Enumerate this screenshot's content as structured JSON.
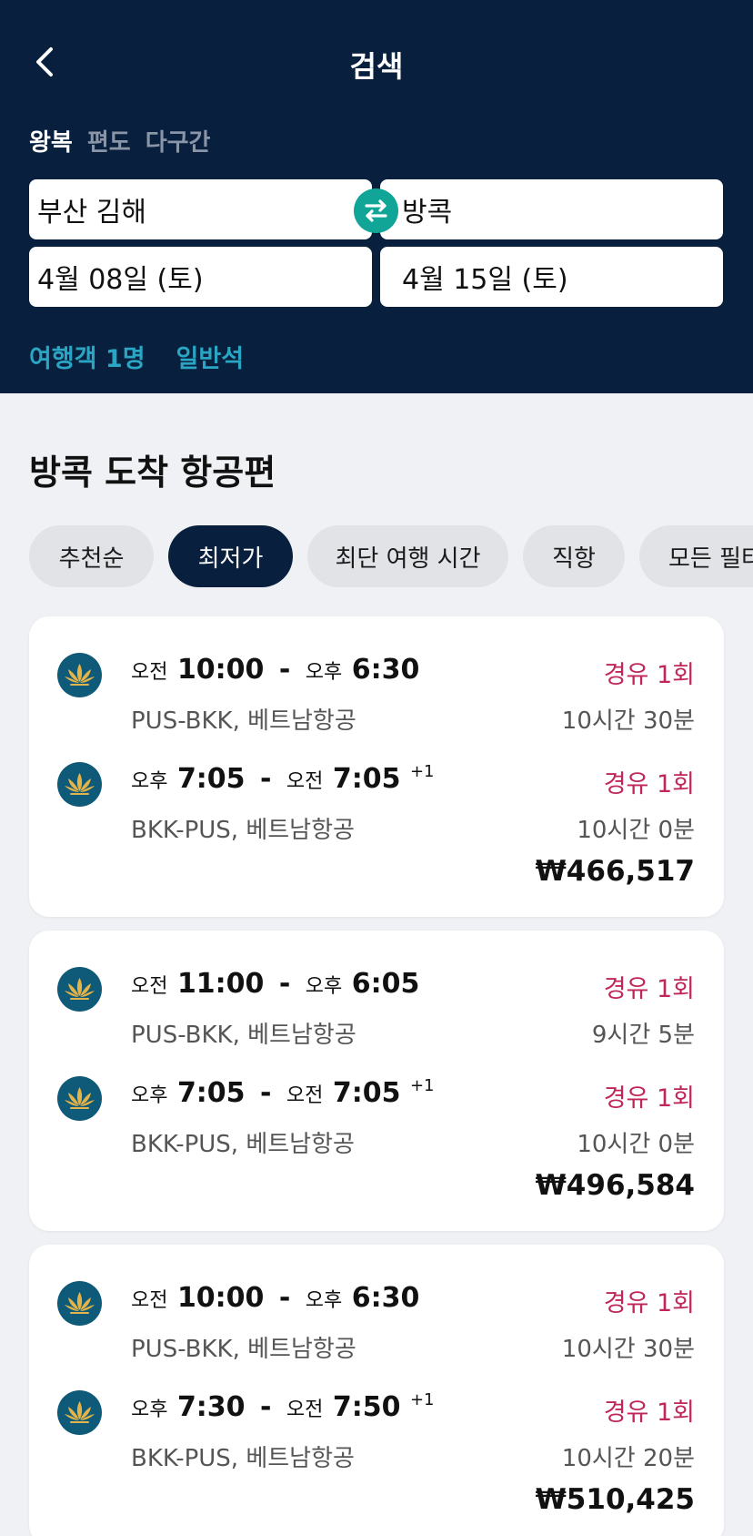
{
  "header": {
    "title": "검색",
    "trip_types": [
      "왕복",
      "편도",
      "다구간"
    ],
    "origin": "부산 김해",
    "destination": "방콕",
    "depart_date": "4월 08일 (토)",
    "return_date": "4월 15일 (토)",
    "passengers": "여행객 1명",
    "cabin": "일반석"
  },
  "section_title": "방콕 도착 항공편",
  "sort_chips": [
    "추천순",
    "최저가",
    "최단 여행 시간",
    "직항",
    "모든 필터"
  ],
  "icons": {
    "back": "chevron-left-icon",
    "swap": "swap-arrows-icon",
    "airline_logo": "lotus-logo-icon"
  },
  "colors": {
    "header_bg": "#08203d",
    "swap_accent": "#10a597",
    "stops_text": "#c0265c",
    "option_text": "#2aa6c4",
    "active_chip": "#08203d"
  },
  "results": [
    {
      "legs": [
        {
          "dep_period": "오전",
          "dep_time": "10:00",
          "arr_period": "오후",
          "arr_time": "6:30",
          "day_offset": "",
          "route": "PUS-BKK, 베트남항공",
          "stops": "경유 1회",
          "duration": "10시간 30분"
        },
        {
          "dep_period": "오후",
          "dep_time": "7:05",
          "arr_period": "오전",
          "arr_time": "7:05",
          "day_offset": "+1",
          "route": "BKK-PUS, 베트남항공",
          "stops": "경유 1회",
          "duration": "10시간 0분"
        }
      ],
      "price": "₩466,517"
    },
    {
      "legs": [
        {
          "dep_period": "오전",
          "dep_time": "11:00",
          "arr_period": "오후",
          "arr_time": "6:05",
          "day_offset": "",
          "route": "PUS-BKK, 베트남항공",
          "stops": "경유 1회",
          "duration": "9시간 5분"
        },
        {
          "dep_period": "오후",
          "dep_time": "7:05",
          "arr_period": "오전",
          "arr_time": "7:05",
          "day_offset": "+1",
          "route": "BKK-PUS, 베트남항공",
          "stops": "경유 1회",
          "duration": "10시간 0분"
        }
      ],
      "price": "₩496,584"
    },
    {
      "legs": [
        {
          "dep_period": "오전",
          "dep_time": "10:00",
          "arr_period": "오후",
          "arr_time": "6:30",
          "day_offset": "",
          "route": "PUS-BKK, 베트남항공",
          "stops": "경유 1회",
          "duration": "10시간 30분"
        },
        {
          "dep_period": "오후",
          "dep_time": "7:30",
          "arr_period": "오전",
          "arr_time": "7:50",
          "day_offset": "+1",
          "route": "BKK-PUS, 베트남항공",
          "stops": "경유 1회",
          "duration": "10시간 20분"
        }
      ],
      "price": "₩510,425"
    }
  ]
}
